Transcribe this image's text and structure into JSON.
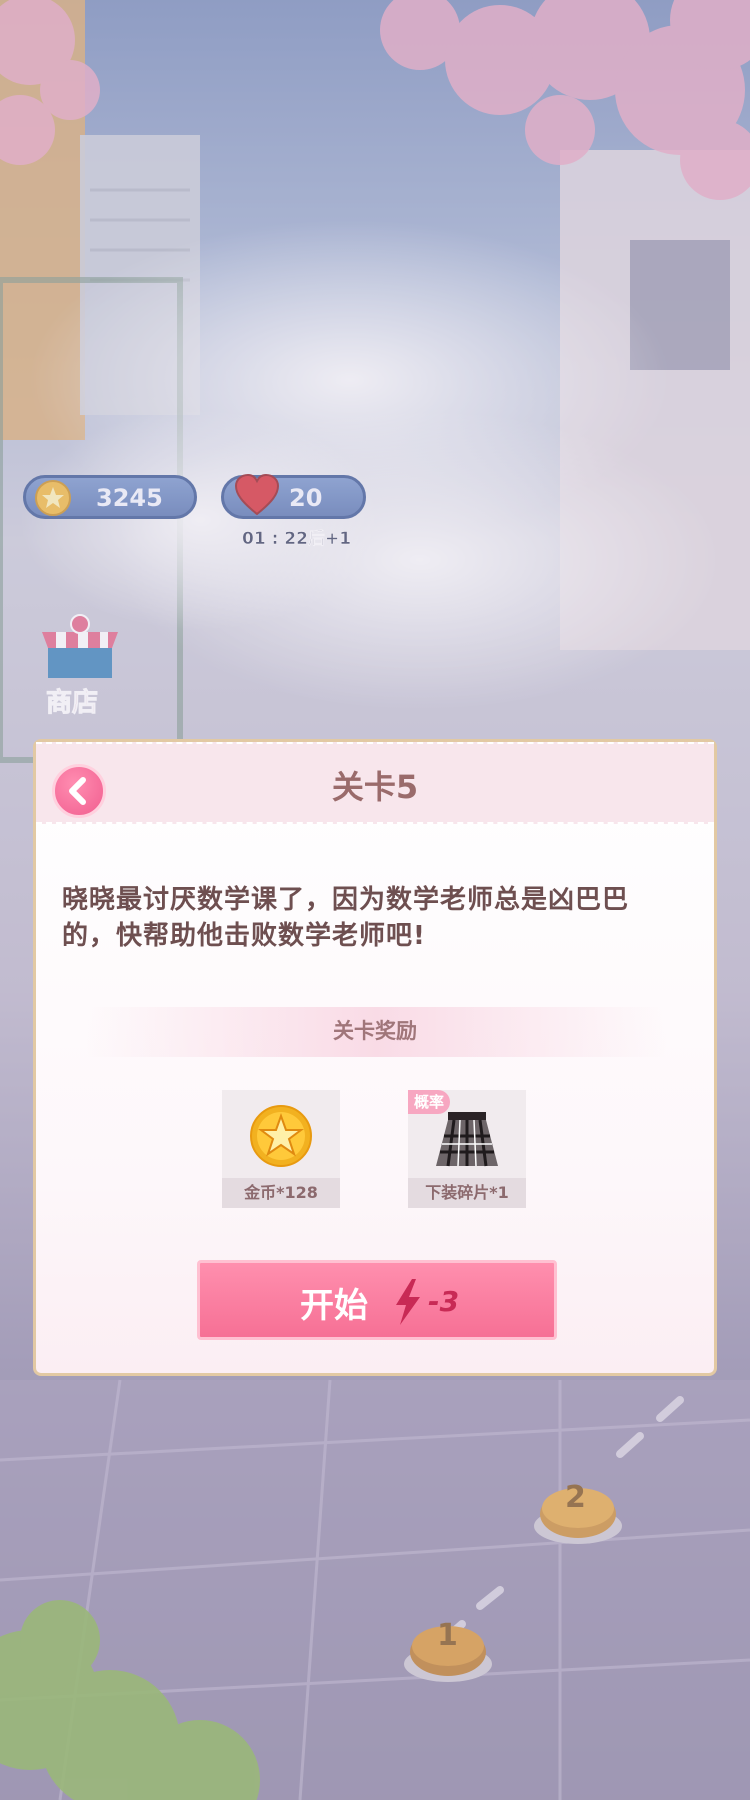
{
  "hud": {
    "coins": "3245",
    "lives": "20",
    "life_timer": "01 : 22后+1"
  },
  "shop": {
    "label": "商店"
  },
  "dialog": {
    "title": "关卡5",
    "story": "晓晓最讨厌数学课了，因为数学老师总是凶巴巴的，快帮助他击败数学老师吧!",
    "reward_title": "关卡奖励",
    "rewards": [
      {
        "label": "金币*128",
        "icon": "gold-star-coin"
      },
      {
        "label": "下装碎片*1",
        "tag": "概率",
        "icon": "plaid-skirt"
      }
    ],
    "start_label": "开始",
    "start_cost": "-3"
  },
  "map": {
    "nodes": [
      {
        "label": "2"
      },
      {
        "label": "1"
      }
    ]
  },
  "colors": {
    "accent": "#f67095",
    "title": "#9a6b6b",
    "frame": "#e2c9a3"
  }
}
